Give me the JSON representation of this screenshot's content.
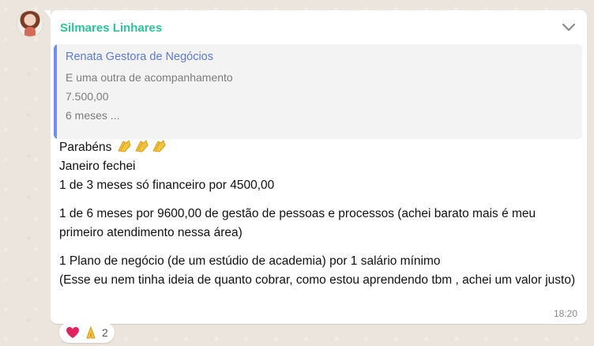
{
  "message": {
    "sender": "Silmares Linhares",
    "quoted": {
      "author": "Renata Gestora de Negócios",
      "lines": [
        "E uma outra de acompanhamento",
        "7.500,00",
        "6 meses ..."
      ]
    },
    "greeting": "Parabéns",
    "greeting_emoji": [
      "clapping-hands",
      "clapping-hands",
      "clapping-hands"
    ],
    "lines": [
      "Janeiro fechei",
      "1 de 3 meses só financeiro por 4500,00",
      "1 de 6 meses por 9600,00 de gestão de pessoas e processos (achei barato mais é meu primeiro atendimento nessa área)",
      "1 Plano de negócio (de um estúdio de academia) por 1 salário mínimo",
      "(Esse eu nem tinha ideia de quanto cobrar, como estou aprendendo tbm , achei um valor justo)"
    ],
    "time": "18:20"
  },
  "reactions": {
    "emojis": [
      "red-heart",
      "folded-hands"
    ],
    "count": "2"
  },
  "colors": {
    "sender": "#2dc29a",
    "quote_bar": "#6f8df2",
    "quote_author": "#5b7bd8"
  }
}
